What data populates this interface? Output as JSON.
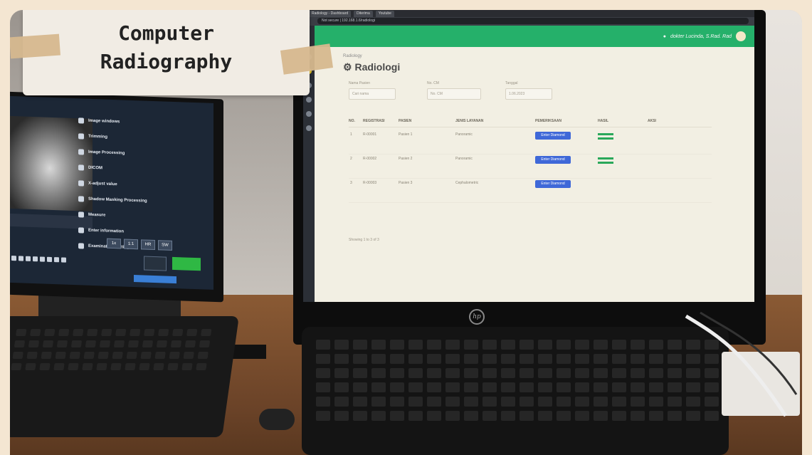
{
  "card": {
    "line1": "Computer",
    "line2": "Radiography"
  },
  "left_screen": {
    "menu": [
      "Image windows",
      "Trimming",
      "Image Processing",
      "DICOM",
      "X-adjust value",
      "Shadow Masking Processing",
      "Measure",
      "Enter information",
      "Examination Setting"
    ],
    "buttons": [
      "1x",
      "1:1",
      "HR",
      "SW"
    ]
  },
  "right_screen": {
    "tabs": [
      "Radiology - Dashboard",
      "Diterima",
      "Youtube"
    ],
    "url": "Not secure | 192.168.1.6/radiologi",
    "user": "dokter Lucinda, S.Rad. Rad",
    "breadcrumb": "Radiology",
    "page_title": "Radiologi",
    "filters": [
      {
        "label": "Nama Pasien",
        "placeholder": "Cari nama"
      },
      {
        "label": "No. CM",
        "placeholder": "No. CM"
      },
      {
        "label": "Tanggal",
        "placeholder": "1.06.2023"
      }
    ],
    "columns": [
      "NO.",
      "REGISTRASI",
      "PASIEN",
      "JENIS LAYANAN",
      "PEMERIKSAAN",
      "HASIL",
      "AKSI"
    ],
    "rows": [
      {
        "no": "1",
        "reg": "R-00001",
        "patient": "Pasien 1",
        "service": "Panoramic",
        "button": "Enter Diamond"
      },
      {
        "no": "2",
        "reg": "R-00002",
        "patient": "Pasien 2",
        "service": "Panoramic",
        "button": "Enter Diamond"
      },
      {
        "no": "3",
        "reg": "R-00003",
        "patient": "Pasien 3",
        "service": "Cephalometric",
        "button": "Enter Diamond"
      }
    ],
    "footer": "Showing 1 to 3 of 3"
  },
  "brand": "hp"
}
